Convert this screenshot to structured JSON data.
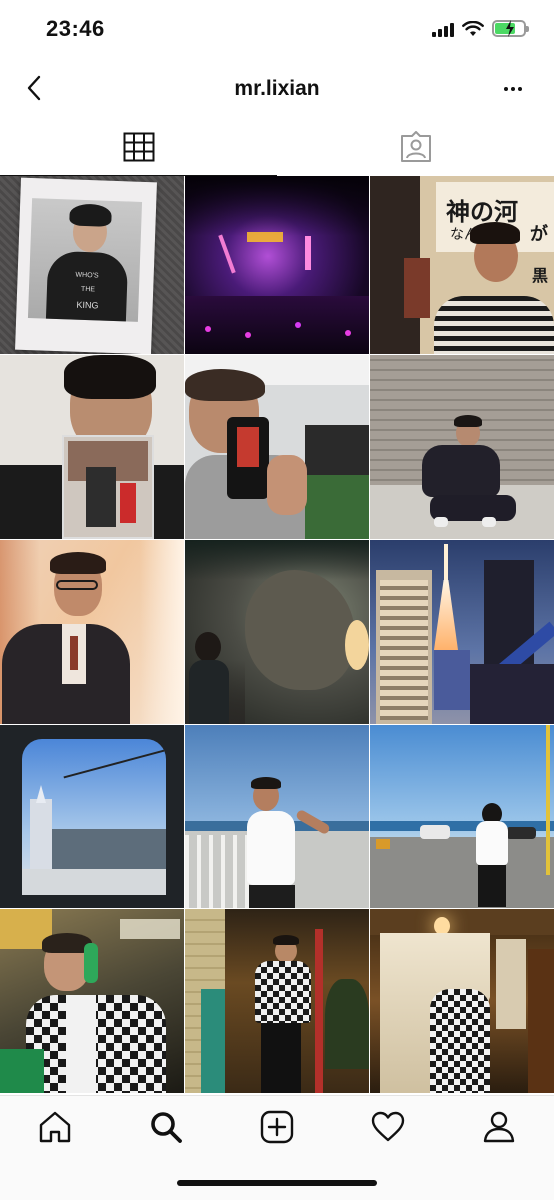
{
  "status_bar": {
    "time": "23:46",
    "signal_bars": 4,
    "wifi": "wifi-icon",
    "battery_charging": true,
    "battery_color": "#4cd964"
  },
  "header": {
    "title": "mr.lixian",
    "back_icon": "chevron-left-icon",
    "more_icon": "ellipsis-icon"
  },
  "tabs": [
    {
      "name": "grid",
      "icon": "grid-icon",
      "active": true
    },
    {
      "name": "tagged",
      "icon": "tagged-person-icon",
      "active": false
    }
  ],
  "photos": [
    {
      "id": "p1",
      "subject": "polaroid on knit blanket",
      "texts": [
        "WHO'S",
        "THE",
        "KING"
      ]
    },
    {
      "id": "p2",
      "subject": "nightclub stage purple lights",
      "texts": []
    },
    {
      "id": "p3",
      "subject": "man in striped shirt before posters",
      "texts": [
        "神の河",
        "なん",
        "が",
        "黒"
      ]
    },
    {
      "id": "p4",
      "subject": "selfie with magazine",
      "texts": []
    },
    {
      "id": "p5",
      "subject": "gym mirror selfie",
      "texts": []
    },
    {
      "id": "p6",
      "subject": "crouching by brick wall",
      "texts": []
    },
    {
      "id": "p7",
      "subject": "man in suit with glasses",
      "texts": []
    },
    {
      "id": "p8",
      "subject": "dark rock cave",
      "texts": []
    },
    {
      "id": "p9",
      "subject": "Tokyo Tower at dusk",
      "texts": []
    },
    {
      "id": "p10",
      "subject": "train window view",
      "texts": []
    },
    {
      "id": "p11",
      "subject": "man by sea railing",
      "texts": []
    },
    {
      "id": "p12",
      "subject": "man on coastal road",
      "texts": []
    },
    {
      "id": "p13",
      "subject": "man in checked shirt with phone booth",
      "texts": []
    },
    {
      "id": "p14",
      "subject": "man in checked shirt in corridor",
      "texts": []
    },
    {
      "id": "p15",
      "subject": "shop noren curtain",
      "texts": []
    }
  ],
  "bottom_nav": [
    {
      "name": "home",
      "icon": "home-icon"
    },
    {
      "name": "search",
      "icon": "search-icon",
      "active": true
    },
    {
      "name": "new-post",
      "icon": "add-square-icon"
    },
    {
      "name": "activity",
      "icon": "heart-icon"
    },
    {
      "name": "profile",
      "icon": "profile-icon"
    }
  ]
}
